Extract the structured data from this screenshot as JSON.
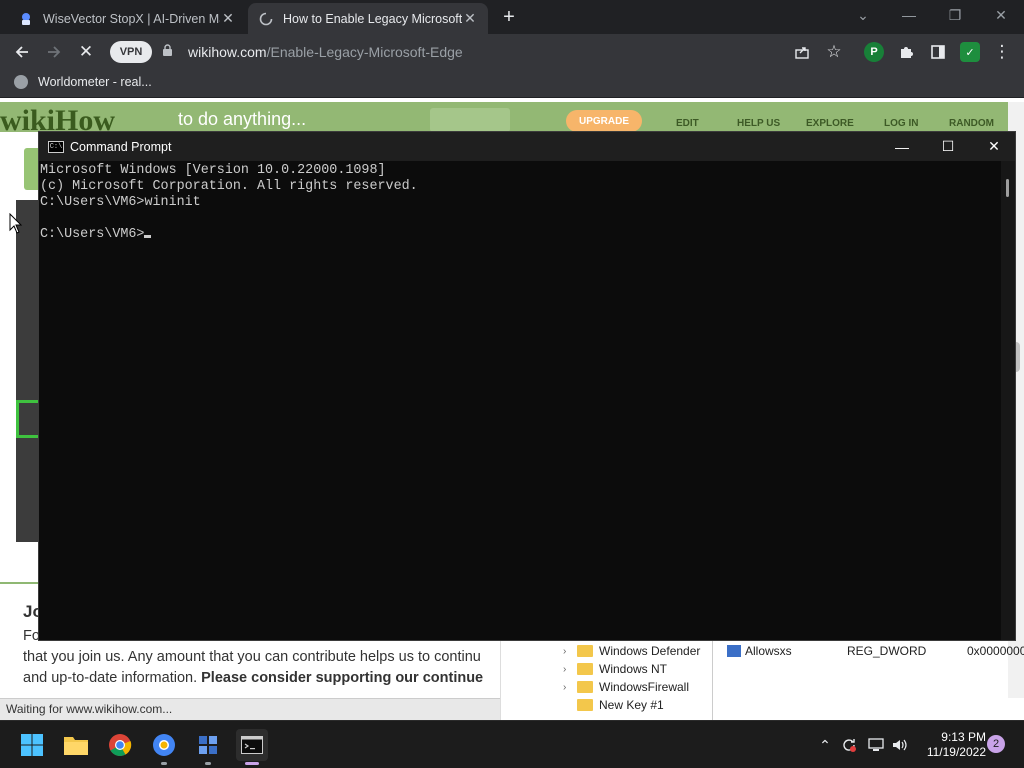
{
  "browser": {
    "tabs": [
      {
        "title": "WiseVector StopX | AI-Driven Ma",
        "active": false,
        "favicon": "wisevector-icon"
      },
      {
        "title": "How to Enable Legacy Microsoft",
        "active": true,
        "favicon": "loading-spinner-icon"
      }
    ],
    "new_tab_label": "+",
    "vpn_label": "VPN",
    "url_host": "wikihow.com",
    "url_path": "/Enable-Legacy-Microsoft-Edge",
    "bookmark": "Worldometer - real...",
    "extension_p_label": "P"
  },
  "page": {
    "logo": "wikiHow",
    "tagline": "to do anything...",
    "upgrade_label": "UPGRADE",
    "nav": [
      "EDIT",
      "HELP US",
      "EXPLORE",
      "LOG IN",
      "RANDOM"
    ],
    "donate_heading": "Jo",
    "donate_line1": "Fo",
    "donate_line2": "that you join us. Any amount that you can contribute helps us to continu",
    "donate_line3_plain": "and up-to-date information. ",
    "donate_line3_bold": "Please consider supporting our continue",
    "status_text": "Waiting for www.wikihow.com..."
  },
  "registry": {
    "tree": [
      "Windows Defender",
      "Windows NT",
      "WindowsFirewall",
      "New Key #1"
    ],
    "value_name": "Allowsxs",
    "value_type": "REG_DWORD",
    "value_data": "0x0000000"
  },
  "cmd": {
    "title": "Command Prompt",
    "icon_label": "C:\\",
    "lines": [
      "Microsoft Windows [Version 10.0.22000.1098]",
      "(c) Microsoft Corporation. All rights reserved.",
      "C:\\Users\\VM6>wininit",
      "",
      "C:\\Users\\VM6>"
    ]
  },
  "taskbar": {
    "time": "9:13 PM",
    "date": "11/19/2022",
    "notification_count": "2"
  },
  "colors": {
    "wikihow_green": "#93b874",
    "cmd_background": "#0c0c0c",
    "taskbar_accent": "#c9a3e8"
  }
}
